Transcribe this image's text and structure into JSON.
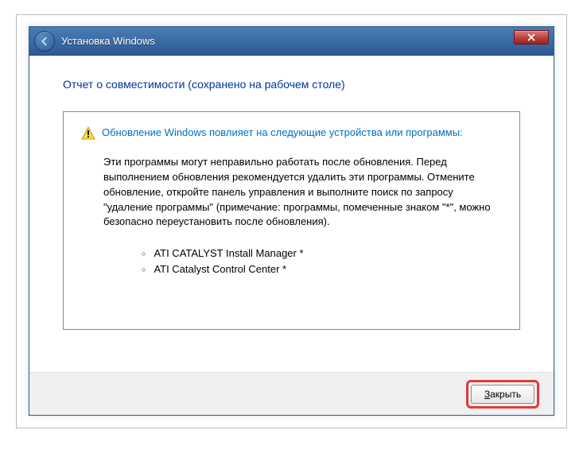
{
  "window": {
    "title": "Установка Windows"
  },
  "content": {
    "heading": "Отчет о совместимости (сохранено на рабочем столе)",
    "warning": "Обновление Windows повлияет на следующие устройства или программы:",
    "body": "Эти программы могут неправильно работать после обновления. Перед выполнением обновления рекомендуется удалить эти программы. Отмените обновление, откройте панель управления и выполните поиск по запросу \"удаление программы\" (примечание: программы, помеченные знаком \"*\", можно безопасно переустановить после обновления).",
    "programs": [
      "ATI CATALYST Install Manager *",
      "ATI Catalyst Control Center *"
    ]
  },
  "footer": {
    "close_prefix": "З",
    "close_rest": "акрыть"
  }
}
